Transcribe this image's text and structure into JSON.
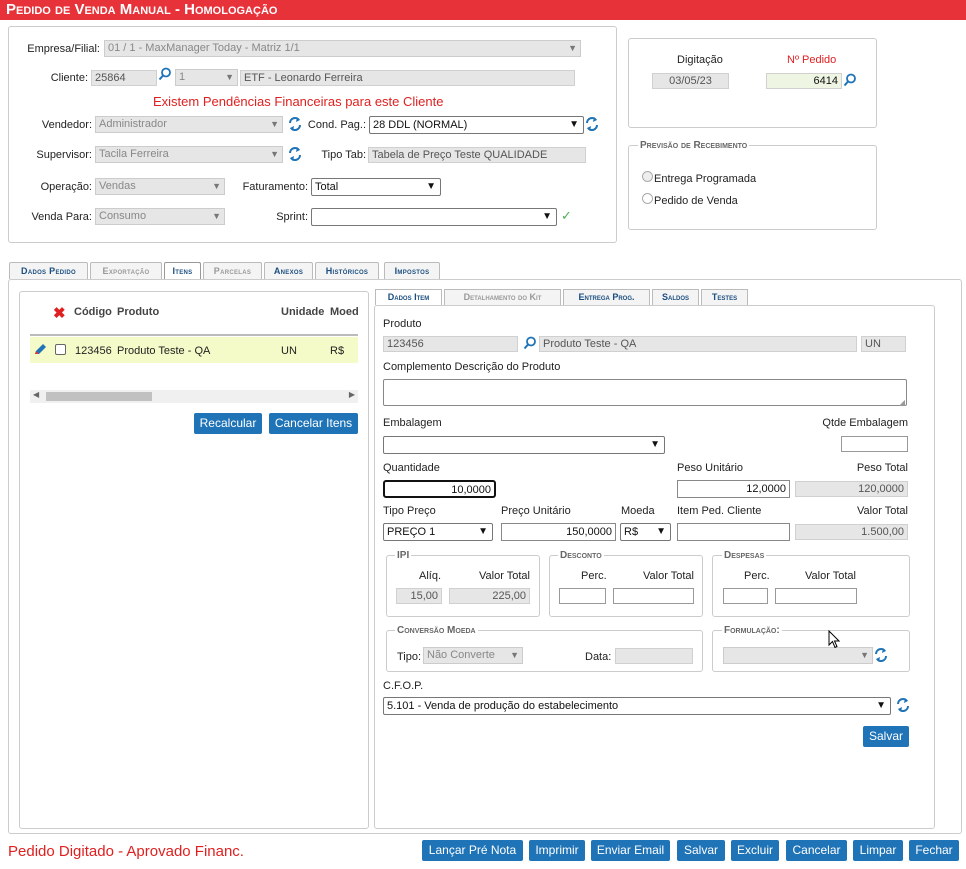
{
  "title": "Pedido de Venda Manual  - Homologação",
  "header": {
    "empresa_label": "Empresa/Filial:",
    "empresa_value": "01 / 1 - MaxManager Today - Matriz 1/1",
    "cliente_label": "Cliente:",
    "cliente_code": "25864",
    "cliente_seq": "1",
    "cliente_name": "ETF - Leonardo Ferreira",
    "pendencias_msg": "Existem Pendências Financeiras para este Cliente",
    "vendedor_label": "Vendedor:",
    "vendedor_value": "Administrador",
    "condpag_label": "Cond. Pag.:",
    "condpag_value": "28 DDL (NORMAL)",
    "supervisor_label": "Supervisor:",
    "supervisor_value": "Tacila Ferreira",
    "tipotab_label": "Tipo Tab:",
    "tipotab_value": "Tabela de Preço Teste QUALIDADE",
    "operacao_label": "Operação:",
    "operacao_value": "Vendas",
    "faturamento_label": "Faturamento:",
    "faturamento_value": "Total",
    "vendapara_label": "Venda Para:",
    "vendapara_value": "Consumo",
    "sprint_label": "Sprint:",
    "sprint_value": ""
  },
  "right_panel": {
    "digitacao_label": "Digitação",
    "digitacao_value": "03/05/23",
    "npedido_label": "Nº Pedido",
    "npedido_value": "6414",
    "previsao_title": "Previsão de Recebimento",
    "radio1": "Entrega Programada",
    "radio2": "Pedido de Venda"
  },
  "tabs": [
    "Dados Pedido",
    "Exportação",
    "Itens",
    "Parcelas",
    "Anexos",
    "Históricos",
    "Impostos"
  ],
  "items_grid": {
    "headers": [
      "Código",
      "Produto",
      "Unidade",
      "Moed"
    ],
    "rows": [
      {
        "codigo": "123456",
        "produto": "Produto Teste - QA",
        "unidade": "UN",
        "moeda": "R$"
      }
    ],
    "recalcular": "Recalcular",
    "cancelar_itens": "Cancelar Itens"
  },
  "item_tabs": [
    "Dados Item",
    "Detalhamento do Kit",
    "Entrega Prog.",
    "Saldos",
    "Testes"
  ],
  "item": {
    "produto_label": "Produto",
    "produto_code": "123456",
    "produto_name": "Produto Teste - QA",
    "produto_un": "UN",
    "complemento_label": "Complemento Descrição do Produto",
    "embalagem_label": "Embalagem",
    "qtde_embalagem_label": "Qtde Embalagem",
    "quantidade_label": "Quantidade",
    "quantidade_value": "10,0000",
    "peso_unit_label": "Peso Unitário",
    "peso_unit_value": "12,0000",
    "peso_total_label": "Peso Total",
    "peso_total_value": "120,0000",
    "tipo_preco_label": "Tipo Preço",
    "tipo_preco_value": "PREÇO 1",
    "preco_unit_label": "Preço Unitário",
    "preco_unit_value": "150,0000",
    "moeda_label": "Moeda",
    "moeda_value": "R$",
    "item_ped_label": "Item Ped. Cliente",
    "valor_total_label": "Valor Total",
    "valor_total_value": "1.500,00",
    "ipi_title": "IPI",
    "ipi_aliq_label": "Alíq.",
    "ipi_valor_label": "Valor Total",
    "ipi_aliq_value": "15,00",
    "ipi_valor_value": "225,00",
    "desconto_title": "Desconto",
    "desc_perc_label": "Perc.",
    "desc_valor_label": "Valor Total",
    "despesas_title": "Despesas",
    "desp_perc_label": "Perc.",
    "desp_valor_label": "Valor Total",
    "conversao_title": "Conversão Moeda",
    "tipo_label": "Tipo:",
    "tipo_value": "Não Converte",
    "data_label": "Data:",
    "formulacao_title": "Formulação:",
    "cfop_label": "C.F.O.P.",
    "cfop_value": "5.101 - Venda de produção do estabelecimento",
    "salvar": "Salvar"
  },
  "footer": {
    "status": "Pedido Digitado - Aprovado Financ.",
    "buttons": [
      "Lançar Pré Nota",
      "Imprimir",
      "Enviar Email",
      "Salvar",
      "Excluir",
      "Cancelar",
      "Limpar",
      "Fechar"
    ]
  },
  "colors": {
    "accent": "#1f73b7",
    "title_bar": "#e8323a",
    "alert": "#e02020",
    "row_highlight": "#f4fbc8"
  }
}
